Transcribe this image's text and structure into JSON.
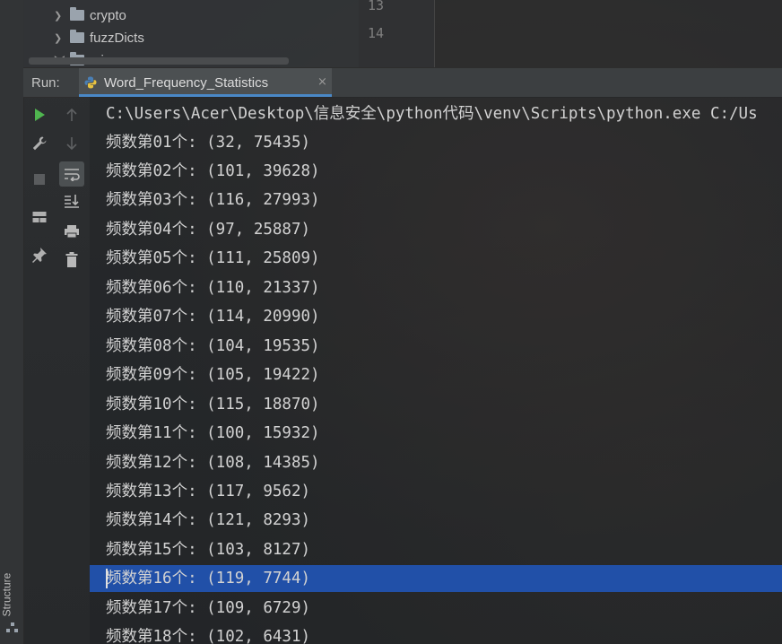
{
  "project_tree": {
    "items": [
      {
        "label": "crypto",
        "expanded": false
      },
      {
        "label": "fuzzDicts",
        "expanded": false
      },
      {
        "label": "misc",
        "expanded": true
      }
    ]
  },
  "editor": {
    "line_numbers": [
      "13",
      "14"
    ]
  },
  "left_strip": {
    "structure_label": "Structure"
  },
  "run_panel": {
    "label": "Run:",
    "tab_label": "Word_Frequency_Statistics",
    "tab_close": "×"
  },
  "toolbar_icons": [
    "run-icon",
    "rerun-icon",
    "stop-icon",
    "layout-icon",
    "pin-icon",
    "up-arrow-icon",
    "down-arrow-icon",
    "soft-wrap-icon",
    "scroll-to-end-icon",
    "print-icon",
    "delete-icon"
  ],
  "console": {
    "command": "C:\\Users\\Acer\\Desktop\\信息安全\\python代码\\venv\\Scripts\\python.exe C:/Us",
    "lines": [
      "频数第01个: (32, 75435)",
      "频数第02个: (101, 39628)",
      "频数第03个: (116, 27993)",
      "频数第04个: (97, 25887)",
      "频数第05个: (111, 25809)",
      "频数第06个: (110, 21337)",
      "频数第07个: (114, 20990)",
      "频数第08个: (104, 19535)",
      "频数第09个: (105, 19422)",
      "频数第10个: (115, 18870)",
      "频数第11个: (100, 15932)",
      "频数第12个: (108, 14385)",
      "频数第13个: (117, 9562)",
      "频数第14个: (121, 8293)",
      "频数第15个: (103, 8127)",
      "频数第16个: (119, 7744)",
      "频数第17个: (109, 6729)",
      "频数第18个: (102, 6431)"
    ],
    "highlighted_index": 15
  },
  "colors": {
    "accent": "#4a88c7",
    "selection": "#2150a8",
    "run_green": "#4fb54f"
  }
}
